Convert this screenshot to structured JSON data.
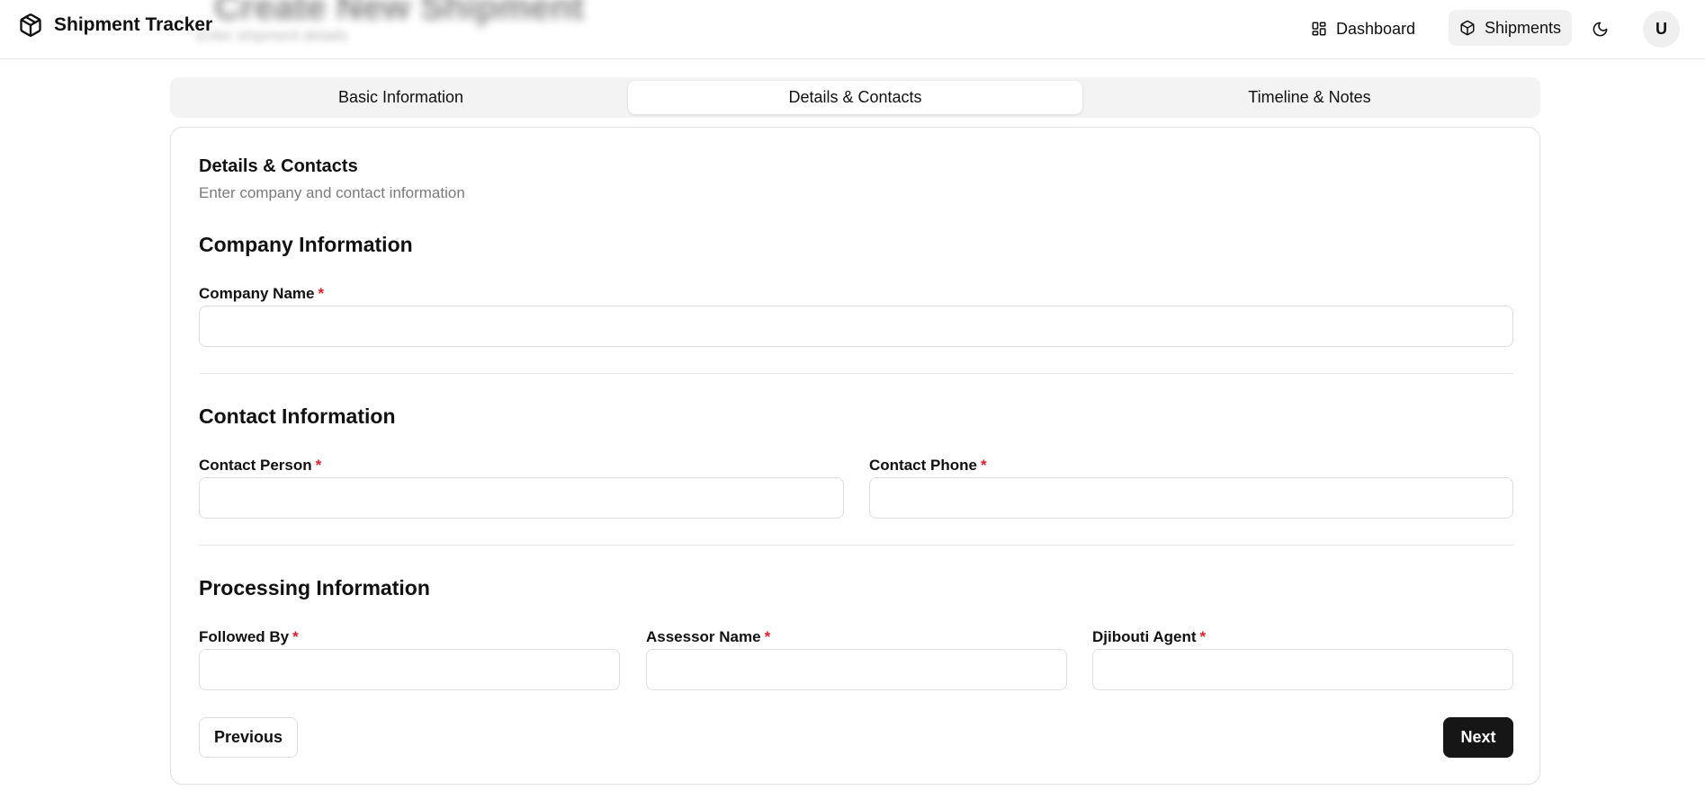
{
  "header": {
    "brand": "Shipment Tracker",
    "nav": {
      "dashboard": "Dashboard",
      "shipments": "Shipments"
    },
    "avatar_initial": "U"
  },
  "tabs": [
    {
      "label": "Basic Information",
      "active": false
    },
    {
      "label": "Details & Contacts",
      "active": true
    },
    {
      "label": "Timeline & Notes",
      "active": false
    }
  ],
  "card": {
    "title": "Details & Contacts",
    "description": "Enter company and contact information"
  },
  "sections": {
    "company": {
      "title": "Company Information",
      "company_name": {
        "label": "Company Name",
        "required_mark": "*",
        "value": ""
      }
    },
    "contact": {
      "title": "Contact Information",
      "contact_person": {
        "label": "Contact Person",
        "required_mark": "*",
        "value": ""
      },
      "contact_phone": {
        "label": "Contact Phone",
        "required_mark": "*",
        "value": ""
      }
    },
    "processing": {
      "title": "Processing Information",
      "followed_by": {
        "label": "Followed By",
        "required_mark": "*",
        "value": ""
      },
      "assessor_name": {
        "label": "Assessor Name",
        "required_mark": "*",
        "value": ""
      },
      "djibouti_agent": {
        "label": "Djibouti Agent",
        "required_mark": "*",
        "value": ""
      }
    }
  },
  "buttons": {
    "previous": "Previous",
    "next": "Next"
  },
  "colors": {
    "required": "#e11d2a",
    "primary_button": "#161616",
    "active_nav_bg": "#f1f1f1"
  }
}
